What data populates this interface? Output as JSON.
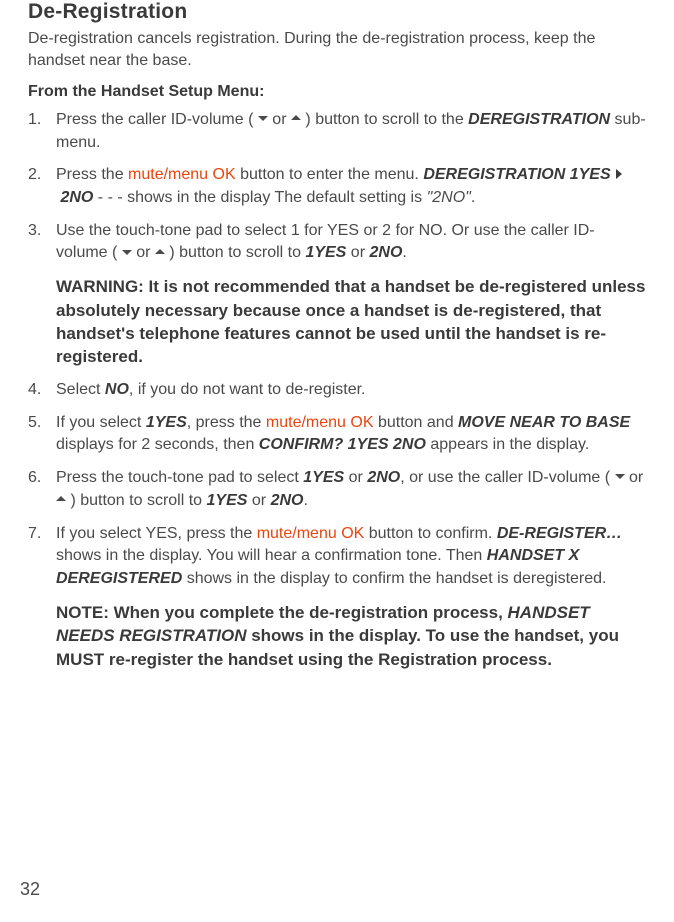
{
  "title": "De-Registration",
  "intro": "De-registration cancels registration. During the de-registration process, keep the handset near the base.",
  "subhead": "From the Handset Setup Menu:",
  "muteMenu": "mute/menu OK",
  "items": {
    "i1a": "Press the caller ID-volume ( ",
    "i1b": " or ",
    "i1c": " ) button to scroll to the ",
    "i1d": "DEREGISTRATION",
    "i1e": " sub-menu.",
    "i2a": "Press the ",
    "i2b": " button to enter the menu. ",
    "i2c": "DEREGISTRATION 1YES",
    "i2d": "2NO",
    "i2e": " - - - shows in the display The default setting is ",
    "i2f": "\"2NO\"",
    "i2g": ".",
    "i3a": "Use the touch-tone pad to select 1 for YES or 2 for NO. Or use the caller ID-volume ( ",
    "i3b": " or ",
    "i3c": " ) button to scroll to ",
    "i3d": "1YES",
    "i3e": " or ",
    "i3f": "2NO",
    "i3g": ".",
    "i4a": "Select ",
    "i4b": "NO",
    "i4c": ", if you do not want to de-register.",
    "i5a": "If you select ",
    "i5b": "1YES",
    "i5c": ", press the ",
    "i5d": " button and ",
    "i5e": "MOVE NEAR TO BASE",
    "i5f": " displays for 2 seconds, then ",
    "i5g": "CONFIRM? 1YES 2NO",
    "i5h": " appears in the display.",
    "i6a": "Press the touch-tone pad to select ",
    "i6b": "1YES",
    "i6c": " or ",
    "i6d": "2NO",
    "i6e": ", or use the caller ID-volume ( ",
    "i6f": " or ",
    "i6g": " ) button to scroll to ",
    "i6h": "1YES",
    "i6i": " or ",
    "i6j": "2NO",
    "i6k": ".",
    "i7a": "If you select YES, press the ",
    "i7b": " button to confirm. ",
    "i7c": "DE-REGISTER…",
    "i7d": " shows in the display. You will hear a confirmation tone. Then ",
    "i7e": "HANDSET X DEREGISTERED",
    "i7f": " shows in the display to confirm the handset is deregistered."
  },
  "warning": {
    "label": "WARNING: ",
    "text": "It is not recommended that a handset be de-registered unless absolutely necessary because once a handset is de-registered, that handset's telephone features cannot be used until the handset is re-registered."
  },
  "note": {
    "label": "NOTE: ",
    "a": "When you complete the de-registration process, ",
    "b": "HANDSET NEEDS REGISTRATION",
    "c": " shows in the display. To use the handset, you MUST re-register the handset using the Registration process."
  },
  "pageNumber": "32"
}
